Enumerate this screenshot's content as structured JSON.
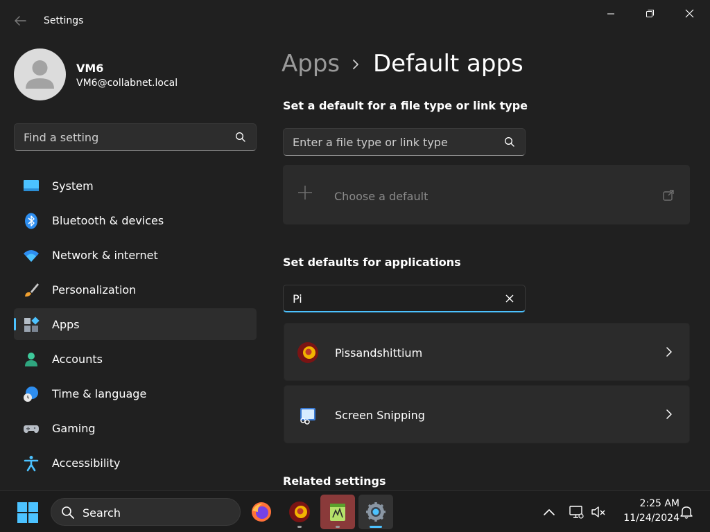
{
  "window": {
    "title": "Settings",
    "controls": [
      "minimize-icon",
      "maximize-icon",
      "close-icon"
    ]
  },
  "user": {
    "name": "VM6",
    "email": "VM6@collabnet.local"
  },
  "sidebar": {
    "search_placeholder": "Find a setting",
    "items": [
      {
        "label": "System",
        "icon": "monitor-icon",
        "active": false
      },
      {
        "label": "Bluetooth & devices",
        "icon": "bluetooth-icon",
        "active": false
      },
      {
        "label": "Network & internet",
        "icon": "wifi-icon",
        "active": false
      },
      {
        "label": "Personalization",
        "icon": "paintbrush-icon",
        "active": false
      },
      {
        "label": "Apps",
        "icon": "apps-icon",
        "active": true
      },
      {
        "label": "Accounts",
        "icon": "person-icon",
        "active": false
      },
      {
        "label": "Time & language",
        "icon": "globe-clock-icon",
        "active": false
      },
      {
        "label": "Gaming",
        "icon": "gamepad-icon",
        "active": false
      },
      {
        "label": "Accessibility",
        "icon": "accessibility-icon",
        "active": false
      }
    ]
  },
  "breadcrumb": {
    "parent": "Apps",
    "current": "Default apps"
  },
  "file_type_section": {
    "heading": "Set a default for a file type or link type",
    "search_placeholder": "Enter a file type or link type",
    "choose_label": "Choose a default"
  },
  "applications_section": {
    "heading": "Set defaults for applications",
    "search_value": "Pi",
    "results": [
      {
        "label": "Pissandshittium",
        "icon": "browser-app-icon"
      },
      {
        "label": "Screen Snipping",
        "icon": "snipping-tool-icon"
      }
    ]
  },
  "related_settings": {
    "heading": "Related settings"
  },
  "taskbar": {
    "search_label": "Search",
    "apps": [
      {
        "name": "firefox-icon",
        "active": false
      },
      {
        "name": "browser-app-icon",
        "active": false
      },
      {
        "name": "notepad-app-icon",
        "active": false
      },
      {
        "name": "settings-gear-icon",
        "active": true
      }
    ],
    "clock": {
      "time": "2:25 AM",
      "date": "11/24/2024"
    }
  },
  "colors": {
    "accent": "#4cc2ff",
    "background": "#202020",
    "card": "#2b2b2b"
  }
}
